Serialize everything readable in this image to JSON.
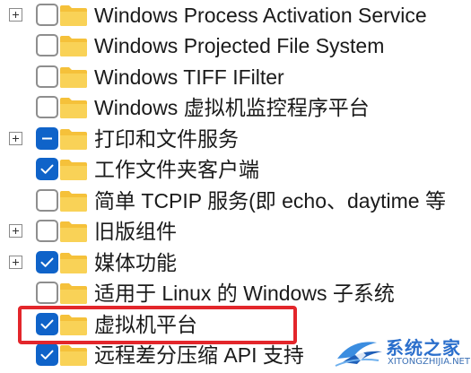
{
  "features": [
    {
      "label": "Windows Process Activation Service",
      "expandable": true,
      "state": "unchecked"
    },
    {
      "label": "Windows Projected File System",
      "expandable": false,
      "state": "unchecked"
    },
    {
      "label": "Windows TIFF IFilter",
      "expandable": false,
      "state": "unchecked"
    },
    {
      "label": "Windows 虚拟机监控程序平台",
      "expandable": false,
      "state": "unchecked"
    },
    {
      "label": "打印和文件服务",
      "expandable": true,
      "state": "partial"
    },
    {
      "label": "工作文件夹客户端",
      "expandable": false,
      "state": "checked"
    },
    {
      "label": "简单 TCPIP 服务(即 echo、daytime 等",
      "expandable": false,
      "state": "unchecked"
    },
    {
      "label": "旧版组件",
      "expandable": true,
      "state": "unchecked"
    },
    {
      "label": "媒体功能",
      "expandable": true,
      "state": "checked"
    },
    {
      "label": "适用于 Linux 的 Windows 子系统",
      "expandable": false,
      "state": "unchecked"
    },
    {
      "label": "虚拟机平台",
      "expandable": false,
      "state": "checked"
    },
    {
      "label": "远程差分压缩 API 支持",
      "expandable": false,
      "state": "checked"
    }
  ],
  "watermark": {
    "title": "系统之家",
    "url": "XITONGZHIJIA.NET"
  },
  "colors": {
    "checkbox_accent": "#0f63c9",
    "folder": "#f5c13a",
    "highlight": "#e3262b"
  }
}
